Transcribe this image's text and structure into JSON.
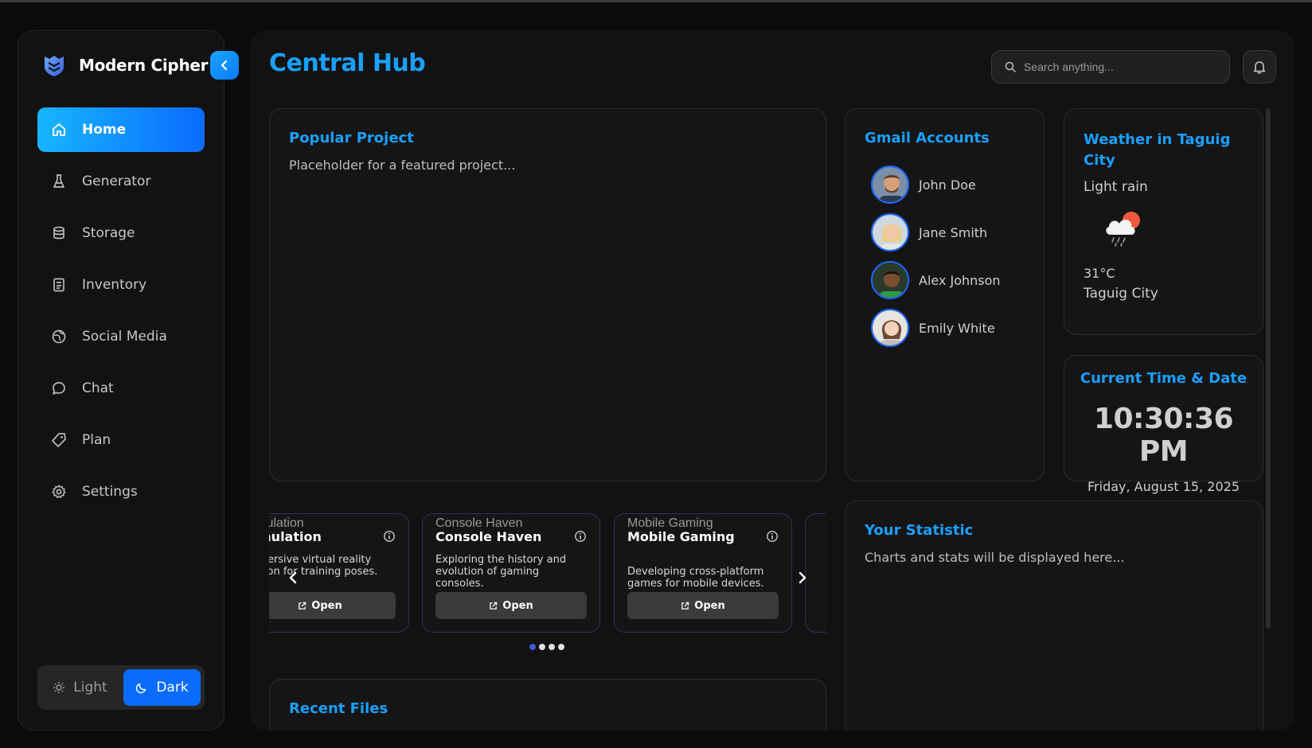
{
  "brand": {
    "name": "Modern Cipher",
    "logo_icon": "shield-logo-icon"
  },
  "sidebar": {
    "items": [
      {
        "label": "Home",
        "icon": "home-icon",
        "active": true
      },
      {
        "label": "Generator",
        "icon": "flask-icon"
      },
      {
        "label": "Storage",
        "icon": "database-icon"
      },
      {
        "label": "Inventory",
        "icon": "inventory-icon"
      },
      {
        "label": "Social Media",
        "icon": "globe-icon"
      },
      {
        "label": "Chat",
        "icon": "chat-bubble-icon"
      },
      {
        "label": "Plan",
        "icon": "tag-icon"
      },
      {
        "label": "Settings",
        "icon": "gear-icon"
      }
    ],
    "theme": {
      "light_label": "Light",
      "dark_label": "Dark",
      "selected": "Dark"
    }
  },
  "header": {
    "title": "Central Hub",
    "search_placeholder": "Search anything..."
  },
  "popular": {
    "title": "Popular Project",
    "placeholder": "Placeholder for a featured project..."
  },
  "gmail": {
    "title": "Gmail Accounts",
    "accounts": [
      {
        "name": "John Doe"
      },
      {
        "name": "Jane Smith"
      },
      {
        "name": "Alex Johnson"
      },
      {
        "name": "Emily White"
      },
      {
        "name": ""
      }
    ]
  },
  "weather": {
    "title": "Weather in Taguig City",
    "condition": "Light rain",
    "temp": "31°C",
    "city": "Taguig City",
    "icon": "cloud-rain-sun-icon"
  },
  "time": {
    "title": "Current Time & Date",
    "clock": "10:30:36 PM",
    "date": "Friday, August 15, 2025"
  },
  "stats": {
    "title": "Your Statistic",
    "placeholder": "Charts and stats will be displayed here..."
  },
  "carousel": {
    "cards": [
      {
        "img_alt": "Simulation",
        "title": "Simulation",
        "desc": "immersive virtual reality ulation for training poses.",
        "open_label": "Open"
      },
      {
        "img_alt": "Console Haven",
        "title": "Console Haven",
        "desc": "Exploring the history and evolution of gaming consoles.",
        "open_label": "Open"
      },
      {
        "img_alt": "Mobile Gaming",
        "title": "Mobile Gaming",
        "desc": "Developing cross-platform games for mobile devices.",
        "open_label": "Open"
      }
    ],
    "dots": 4,
    "active_dot": 0
  },
  "recent": {
    "title": "Recent Files"
  }
}
